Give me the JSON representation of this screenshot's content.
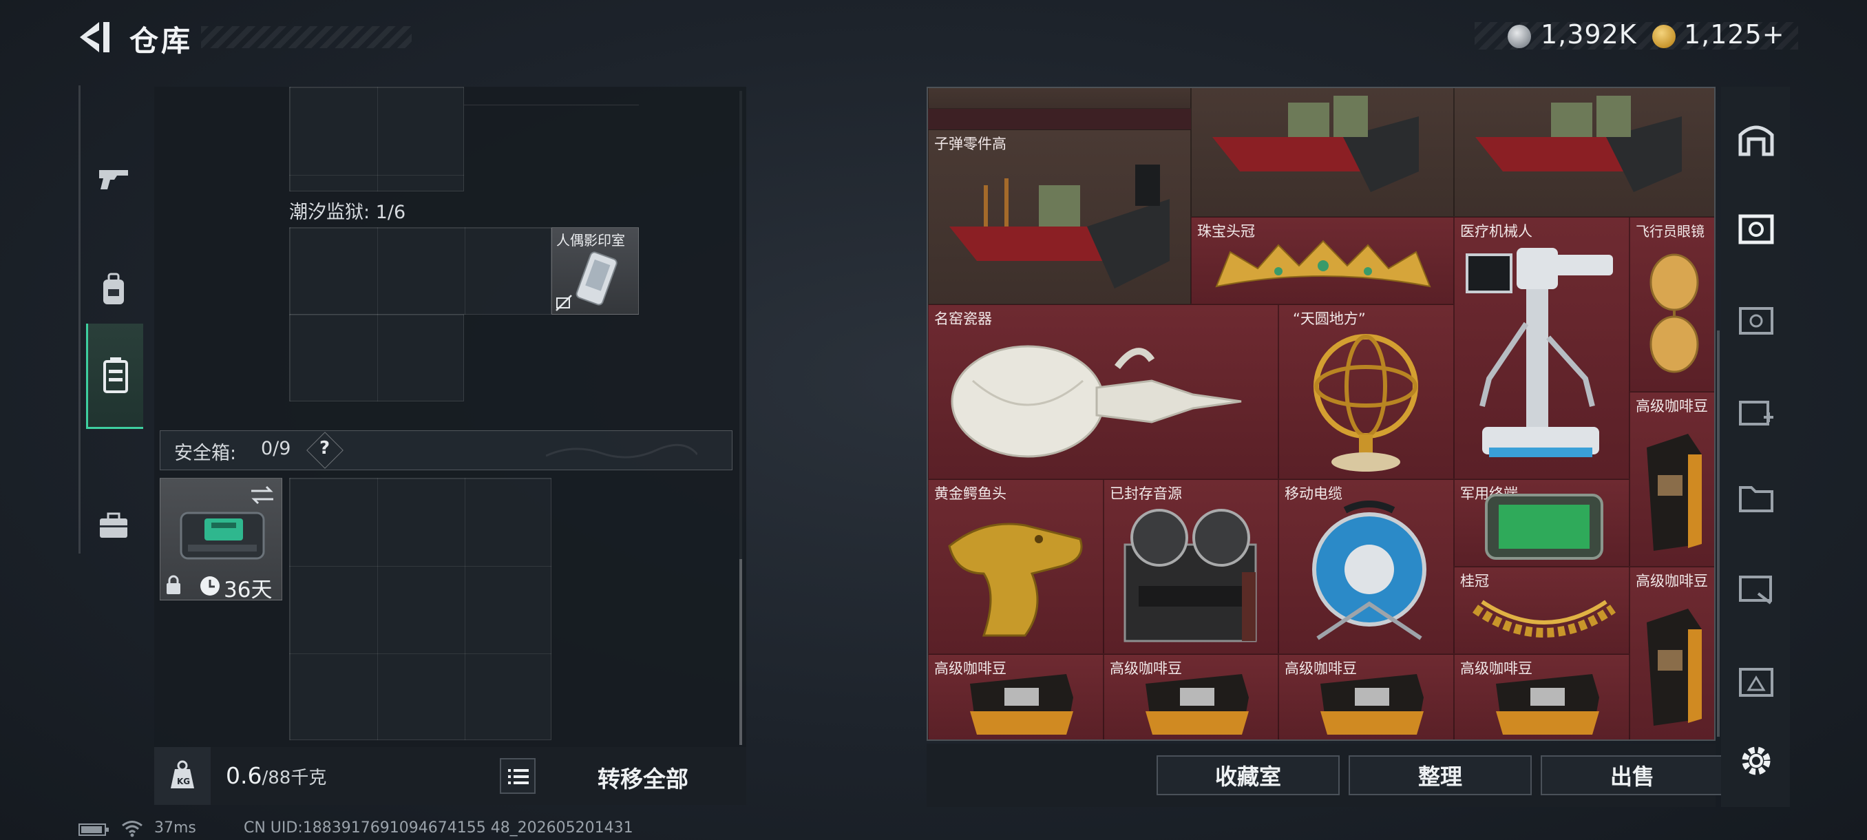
{
  "header": {
    "title": "仓库",
    "currency": [
      {
        "icon": "silver-coin-icon",
        "value": "1,392K",
        "color": "#b8bcc2"
      },
      {
        "icon": "gold-token-icon",
        "value": "1,125",
        "suffix": "+",
        "color": "#d5a63a"
      }
    ]
  },
  "left_tabs": [
    {
      "name": "weapons",
      "icon": "gun-icon",
      "active": false
    },
    {
      "name": "gear",
      "icon": "backpack-icon",
      "active": false
    },
    {
      "name": "warehouse",
      "icon": "locker-icon",
      "active": true
    },
    {
      "name": "supplies",
      "icon": "briefcase-icon",
      "active": false
    }
  ],
  "container": {
    "label": "潮汐监狱: 1/6",
    "item_name": "人偶影印室"
  },
  "safe_box": {
    "label": "安全箱:",
    "count": "0/9",
    "help": "?",
    "duration": "36天"
  },
  "capacity": {
    "current": "0.6",
    "max": "/88千克",
    "transfer_all": "转移全部"
  },
  "stash_items": [
    {
      "name": "子弹零件高",
      "color": "#4a3a34"
    },
    {
      "name": "珠宝头冠"
    },
    {
      "name": "医疗机械人"
    },
    {
      "name": "飞行员眼镜"
    },
    {
      "name": "名窑瓷器"
    },
    {
      "name": "“天圆地方”"
    },
    {
      "name": "高级咖啡豆"
    },
    {
      "name": "黄金鳄鱼头"
    },
    {
      "name": "已封存音源"
    },
    {
      "name": "移动电缆"
    },
    {
      "name": "军用终端"
    },
    {
      "name": "桂冠"
    },
    {
      "name": "高级咖啡豆"
    },
    {
      "name": "高级咖啡豆"
    },
    {
      "name": "高级咖啡豆"
    },
    {
      "name": "高级咖啡豆"
    },
    {
      "name": "高级咖啡豆"
    }
  ],
  "actions": {
    "collection": "收藏室",
    "sort": "整理",
    "sell": "出售"
  },
  "right_sidebar": [
    {
      "icon": "safe-house-icon"
    },
    {
      "icon": "stash-tab-1-icon"
    },
    {
      "icon": "stash-tab-2-icon"
    },
    {
      "icon": "stash-tab-3-icon"
    },
    {
      "icon": "stash-tab-4-icon"
    },
    {
      "icon": "stash-tab-5-icon"
    },
    {
      "icon": "stash-tab-6-icon"
    },
    {
      "icon": "settings-gear-icon"
    }
  ],
  "footer": {
    "ping": "37ms",
    "uid": "CN UID:1883917691094674155 48_202605201431"
  }
}
